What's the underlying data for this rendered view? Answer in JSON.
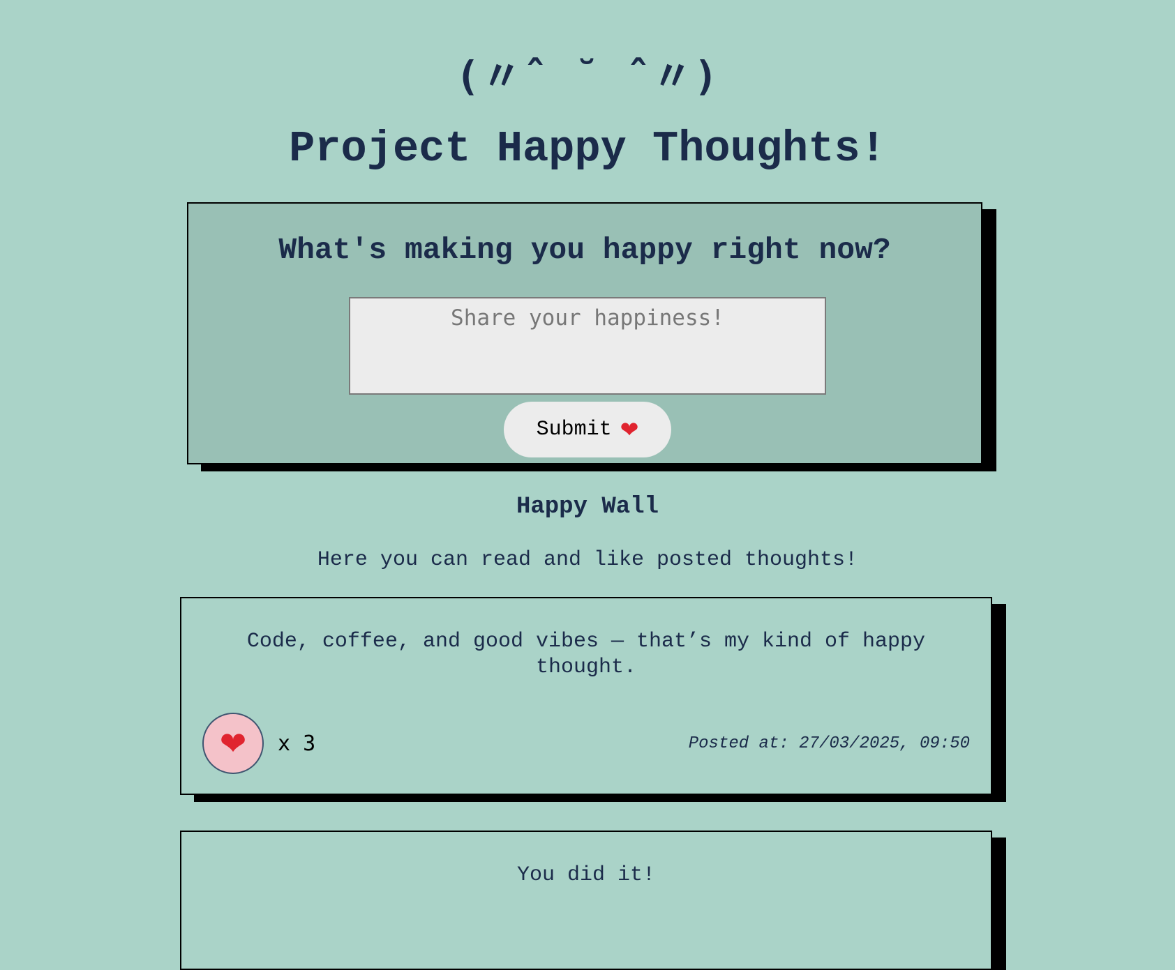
{
  "header": {
    "kaomoji": "(〃ˆ ˘ ˆ〃)",
    "title": "Project Happy Thoughts!"
  },
  "form": {
    "heading": "What's making you happy right now?",
    "input_placeholder": "Share your happiness!",
    "input_value": "",
    "submit_label": "Submit",
    "submit_icon": "heart-icon"
  },
  "wall": {
    "title": "Happy Wall",
    "subtitle": "Here you can read and like posted thoughts!"
  },
  "thoughts": [
    {
      "message": "Code, coffee, and good vibes — that’s my kind of happy thought.",
      "like_icon": "heart-icon",
      "likes_label": "x 3",
      "posted_at": "Posted at: 27/03/2025, 09:50"
    },
    {
      "message": "You did it!"
    }
  ],
  "colors": {
    "background": "#aad3c8",
    "form_background": "#99c0b5",
    "text": "#1b2b4a",
    "like_button": "#f4c2c9",
    "heart": "#e0242f",
    "shadow": "#000000"
  }
}
